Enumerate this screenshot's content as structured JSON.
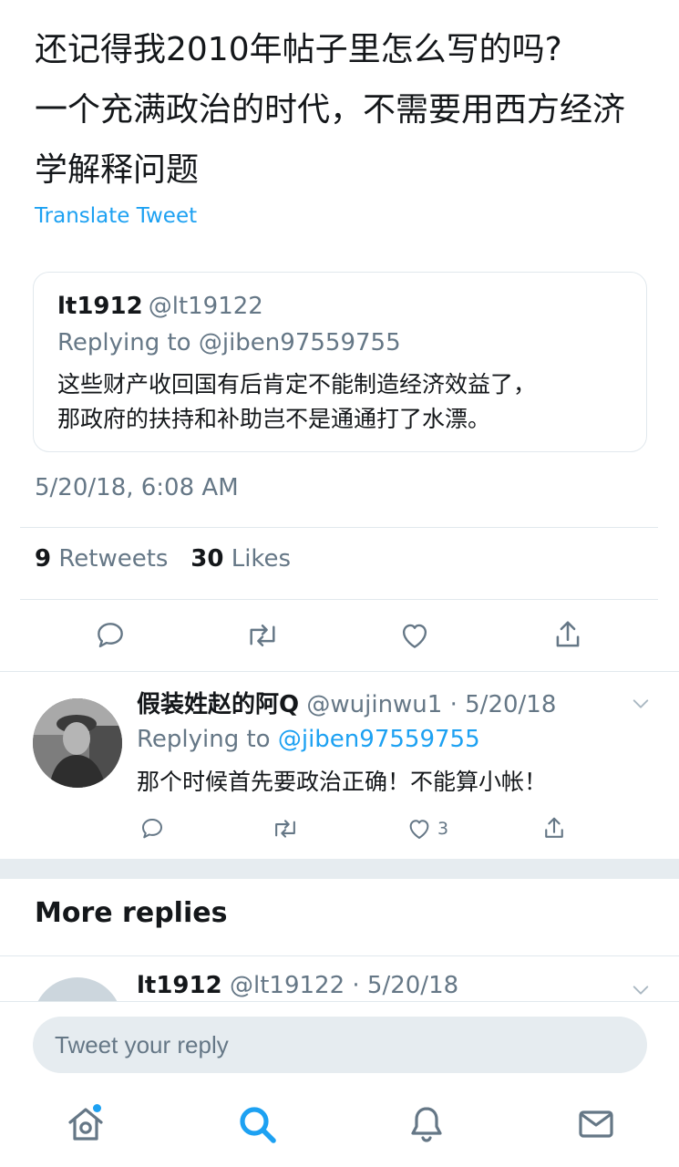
{
  "tweet": {
    "text": "还记得我2010年帖子里怎么写的吗?\n一个充满政治的时代，不需要用西方经济学解释问题",
    "translate_label": "Translate Tweet",
    "timestamp": "5/20/18, 6:08 AM",
    "retweets_count": "9",
    "retweets_label": "Retweets",
    "likes_count": "30",
    "likes_label": "Likes"
  },
  "quoted_tweet": {
    "name": "lt1912",
    "handle": "@lt19122",
    "replying_to": "Replying to @jiben97559755",
    "text": "这些财产收回国有后肯定不能制造经济效益了，\n那政府的扶持和补助岂不是通通打了水漂。"
  },
  "reply": {
    "name": "假装姓赵的阿Q",
    "handle": "@wujinwu1",
    "sep": " · ",
    "date": "5/20/18",
    "replying_prefix": "Replying to ",
    "replying_mention": "@jiben97559755",
    "text": "那个时候首先要政治正确！不能算小帐！",
    "like_count": "3"
  },
  "more_replies_title": "More replies",
  "next_reply": {
    "name": "lt1912",
    "handle": "@lt19122",
    "sep": " · ",
    "date": "5/20/18"
  },
  "compose": {
    "placeholder": "Tweet your reply"
  },
  "colors": {
    "link": "#1da1f2",
    "secondary_text": "#657786",
    "icon": "#657786",
    "divider": "#e1e8ed"
  }
}
